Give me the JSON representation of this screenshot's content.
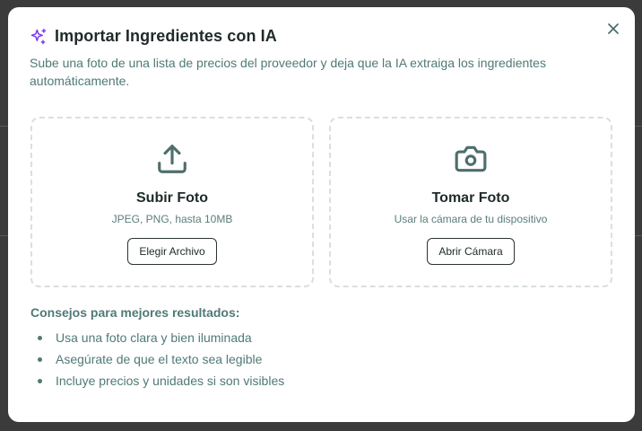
{
  "dialog": {
    "title": "Importar Ingredientes con IA",
    "subtitle": "Sube una foto de una lista de precios del proveedor y deja que la IA extraiga los ingredientes automáticamente.",
    "title_icon": "sparkles-icon",
    "close_icon": "close-icon",
    "accent_color": "#7c3aed"
  },
  "upload_card": {
    "icon": "upload-icon",
    "title": "Subir Foto",
    "subtitle": "JPEG, PNG, hasta 10MB",
    "button_label": "Elegir Archivo"
  },
  "camera_card": {
    "icon": "camera-icon",
    "title": "Tomar Foto",
    "subtitle": "Usar la cámara de tu dispositivo",
    "button_label": "Abrir Cámara"
  },
  "tips": {
    "title": "Consejos para mejores resultados:",
    "items": [
      "Usa una foto clara y bien iluminada",
      "Asegúrate de que el texto sea legible",
      "Incluye precios y unidades si son visibles"
    ]
  }
}
